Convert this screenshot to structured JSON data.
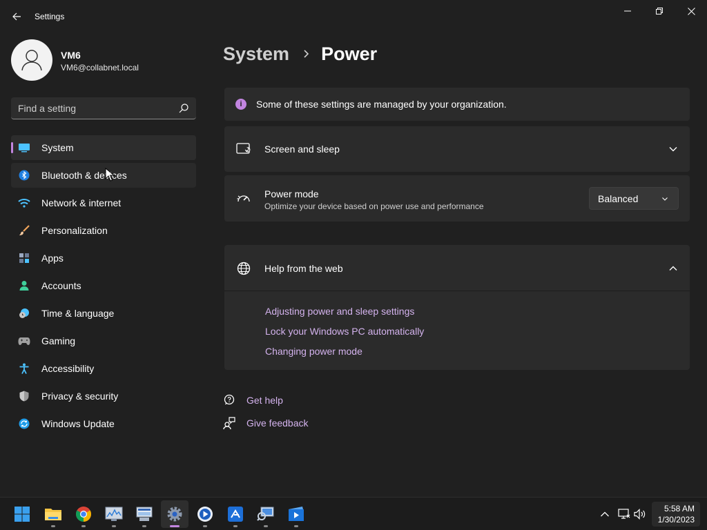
{
  "window": {
    "title": "Settings"
  },
  "profile": {
    "name": "VM6",
    "email": "VM6@collabnet.local"
  },
  "search": {
    "placeholder": "Find a setting"
  },
  "sidebar": {
    "items": [
      {
        "label": "System",
        "icon": "monitor-icon",
        "selected": true
      },
      {
        "label": "Bluetooth & devices",
        "icon": "bluetooth-icon"
      },
      {
        "label": "Network & internet",
        "icon": "wifi-icon"
      },
      {
        "label": "Personalization",
        "icon": "brush-icon"
      },
      {
        "label": "Apps",
        "icon": "apps-icon"
      },
      {
        "label": "Accounts",
        "icon": "person-icon"
      },
      {
        "label": "Time & language",
        "icon": "clock-globe-icon"
      },
      {
        "label": "Gaming",
        "icon": "gamepad-icon"
      },
      {
        "label": "Accessibility",
        "icon": "accessibility-icon"
      },
      {
        "label": "Privacy & security",
        "icon": "shield-icon"
      },
      {
        "label": "Windows Update",
        "icon": "update-icon"
      }
    ]
  },
  "breadcrumb": {
    "parent": "System",
    "current": "Power"
  },
  "info_banner": {
    "text": "Some of these settings are managed by your organization.",
    "icon_glyph": "i"
  },
  "screen_sleep": {
    "title": "Screen and sleep"
  },
  "power_mode": {
    "title": "Power mode",
    "subtitle": "Optimize your device based on power use and performance",
    "selected": "Balanced"
  },
  "help_web": {
    "title": "Help from the web",
    "links": [
      "Adjusting power and sleep settings",
      "Lock your Windows PC automatically",
      "Changing power mode"
    ]
  },
  "footer": {
    "get_help": "Get help",
    "give_feedback": "Give feedback"
  },
  "taskbar": {
    "apps": [
      "start-icon",
      "file-explorer-icon",
      "chrome-icon",
      "resource-monitor-icon",
      "remote-desktop-icon",
      "settings-icon",
      "media-player-icon",
      "remote-assist-icon",
      "network-search-icon",
      "movie-maker-icon"
    ],
    "time": "5:58 AM",
    "date": "1/30/2023"
  },
  "colors": {
    "accent": "#c285e0",
    "link": "#d4b3ee",
    "background": "#202020",
    "card": "#2b2b2b"
  }
}
